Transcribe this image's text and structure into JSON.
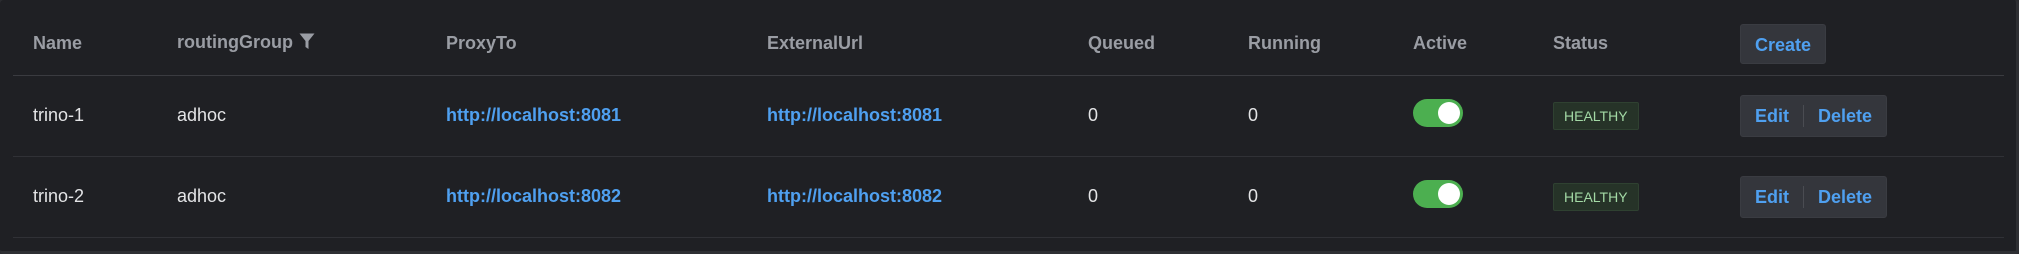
{
  "table": {
    "headers": {
      "name": "Name",
      "routing_group": "routingGroup",
      "proxy_to": "ProxyTo",
      "external_url": "ExternalUrl",
      "queued": "Queued",
      "running": "Running",
      "active": "Active",
      "status": "Status"
    },
    "filter_icon": "filter-icon",
    "create_label": "Create",
    "rows": [
      {
        "name": "trino-1",
        "routing_group": "adhoc",
        "proxy_to": "http://localhost:8081",
        "external_url": "http://localhost:8081",
        "queued": "0",
        "running": "0",
        "active": true,
        "status": "HEALTHY",
        "edit_label": "Edit",
        "delete_label": "Delete"
      },
      {
        "name": "trino-2",
        "routing_group": "adhoc",
        "proxy_to": "http://localhost:8082",
        "external_url": "http://localhost:8082",
        "queued": "0",
        "running": "0",
        "active": true,
        "status": "HEALTHY",
        "edit_label": "Edit",
        "delete_label": "Delete"
      }
    ]
  },
  "colors": {
    "background": "#1f2024",
    "link": "#4fa0f0",
    "toggle_on": "#4caf50",
    "status_healthy_text": "#a3d9a5",
    "status_healthy_bg": "#263328"
  }
}
